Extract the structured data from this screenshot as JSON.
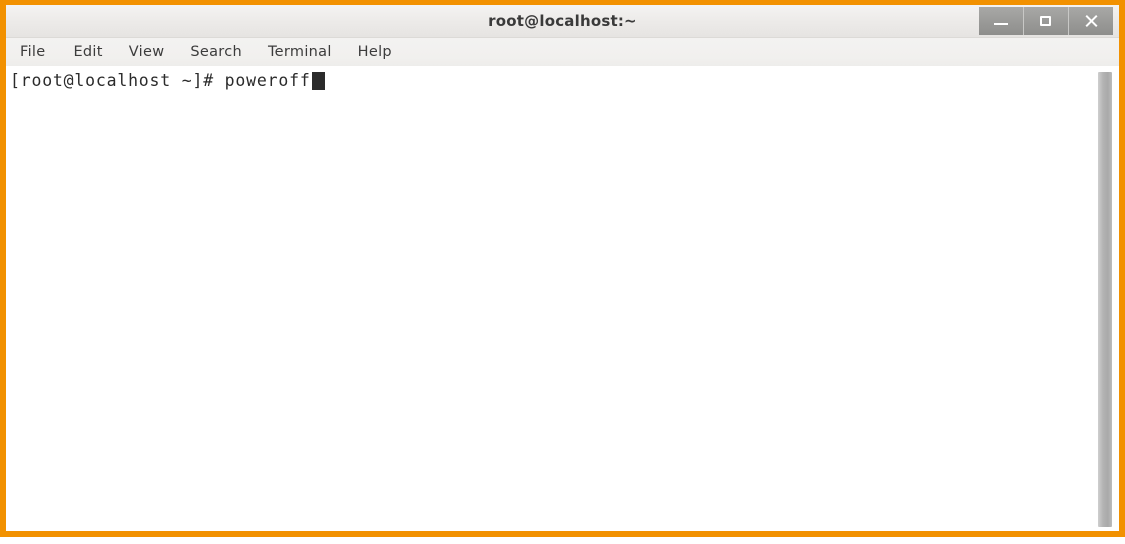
{
  "window": {
    "title": "root@localhost:~",
    "frame_color": "#f29100",
    "controls": {
      "minimize_label": "Minimize",
      "maximize_label": "Maximize",
      "close_label": "Close"
    }
  },
  "menu": {
    "items": [
      {
        "label": "File"
      },
      {
        "label": "Edit"
      },
      {
        "label": "View"
      },
      {
        "label": "Search"
      },
      {
        "label": "Terminal"
      },
      {
        "label": "Help"
      }
    ]
  },
  "terminal": {
    "lines": [
      {
        "prompt": "[root@localhost ~]#",
        "command": " poweroff"
      }
    ],
    "cursor": "block",
    "text_color": "#2b2b2b",
    "background_color": "#ffffff"
  }
}
